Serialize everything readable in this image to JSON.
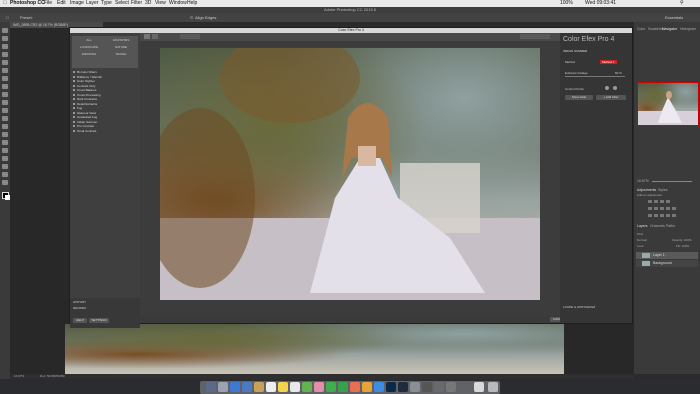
{
  "mac_menu": {
    "items": [
      "Photoshop CC",
      "File",
      "Edit",
      "Image",
      "Layer",
      "Type",
      "Select",
      "Filter",
      "3D",
      "View",
      "Window",
      "Help"
    ],
    "clock": "Wed 09:03:41",
    "battery": "100%"
  },
  "app": {
    "title": "Adobe Photoshop CC 2015.5",
    "doc_tab": "IMG_0895.CR2 @ 16.7% (RGB/8*)",
    "options": {
      "preset_label": "Preset:",
      "align_edges": "Align Edges",
      "essentials": "Essentials"
    }
  },
  "plugin": {
    "window_title": "Color Efex Pro 4",
    "brand": "Color Efex Pro 4",
    "filter_tabs": [
      "ALL",
      "FAVORITES",
      "LANDSCAPE",
      "NATURE",
      "WEDDING",
      "TRAVEL"
    ],
    "filters": [
      "Bi-Color Filters",
      "Brilliance / Warmth",
      "Color Stylizer",
      "Contrast Only",
      "Cross Balance",
      "Cross Processing",
      "Dark Contrasts",
      "Detail Extractor",
      "Fog",
      "Glamour Glow",
      "Graduated Fog",
      "Indian Summer",
      "Pro Contrast",
      "Tonal Contrast"
    ],
    "panel_filter": "INDIAN SUMMER",
    "method_label": "Method",
    "method_value": "Method 1",
    "strength_label": "Enhance Foliage",
    "strength_value": "50 %",
    "control_points_label": "Control Points",
    "add_filter": "+ Add Filter",
    "show_hide": "Show Hide",
    "loupe": "LOUPE & HISTOGRAM",
    "history": "HISTORY",
    "recipes": "RECIPES",
    "help_btn": "HELP",
    "settings_btn": "SETTINGS",
    "cancel_btn": "CANCEL",
    "brush_btn": "BRUSH",
    "ok_btn": "OK"
  },
  "right_panels": {
    "tabs_top": [
      "Color",
      "Swatches",
      "Navigator",
      "Histogram"
    ],
    "zoom": "16.67%",
    "adjustments_tabs": [
      "Adjustments",
      "Styles"
    ],
    "add_adjustment": "Add an adjustment",
    "layer_tabs": [
      "Layers",
      "Channels",
      "Paths"
    ],
    "kind": "Kind",
    "blend": "Normal",
    "opacity": "Opacity: 100%",
    "lock": "Lock:",
    "fill": "Fill: 100%",
    "layers": [
      "Layer 1",
      "Background"
    ]
  },
  "status": {
    "zoom": "16.67%",
    "doc": "Doc: 59.8M/59.8M"
  }
}
